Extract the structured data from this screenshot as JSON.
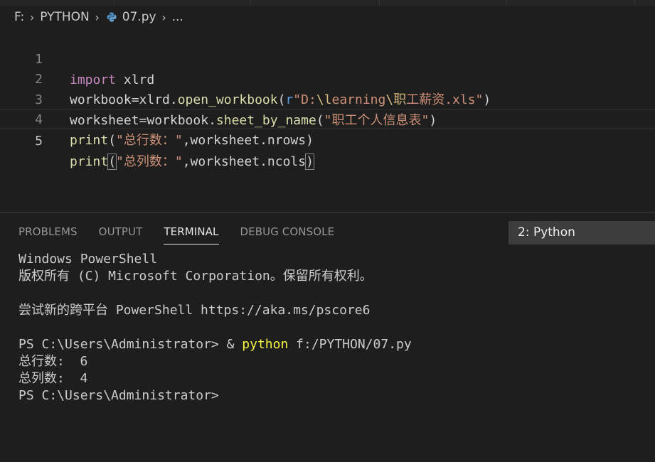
{
  "breadcrumb": {
    "drive": "F:",
    "folder": "PYTHON",
    "file": "07.py",
    "more": "...",
    "file_icon": "python-file-icon"
  },
  "editor": {
    "lines": [
      {
        "number": "1",
        "kw": "import",
        "rest": " xlrd"
      },
      {
        "number": "2",
        "pre": "workbook=xlrd.",
        "fn": "open_workbook",
        "open": "(",
        "prefix": "r",
        "str1": "\"D:",
        "esc1": "\\l",
        "str2": "earning",
        "esc2": "\\职",
        "str3": "工薪资.xls\"",
        "close": ")"
      },
      {
        "number": "3",
        "pre": "worksheet=workbook.",
        "fn": "sheet_by_name",
        "open": "(",
        "str": "\"职工个人信息表\"",
        "close": ")"
      },
      {
        "number": "4",
        "fn": "print",
        "open": "(",
        "str": "\"总行数：\"",
        "rest": ",worksheet.nrows",
        "close": ")"
      },
      {
        "number": "5",
        "fn": "print",
        "open": "(",
        "str": "\"总列数：\"",
        "rest": ",worksheet.ncols",
        "close": ")"
      }
    ]
  },
  "panel": {
    "tabs": [
      "PROBLEMS",
      "OUTPUT",
      "TERMINAL",
      "DEBUG CONSOLE"
    ],
    "active_tab": "TERMINAL",
    "terminal_select": "2: Python"
  },
  "terminal": {
    "line1": "Windows PowerShell",
    "line2": "版权所有 (C) Microsoft Corporation。保留所有权利。",
    "line3": "尝试新的跨平台 PowerShell https://aka.ms/pscore6",
    "prompt1": "PS C:\\Users\\Administrator> & ",
    "cmd": "python",
    "args": " f:/PYTHON/07.py",
    "out1": "总行数:  6",
    "out2": "总列数:  4",
    "prompt2": "PS C:\\Users\\Administrator>"
  },
  "colors": {
    "background": "#1e1e1e",
    "keyword": "#c586c0",
    "function": "#dcdcaa",
    "string": "#ce9178",
    "escape": "#d7ba7d",
    "terminal_command": "#f5f543"
  }
}
